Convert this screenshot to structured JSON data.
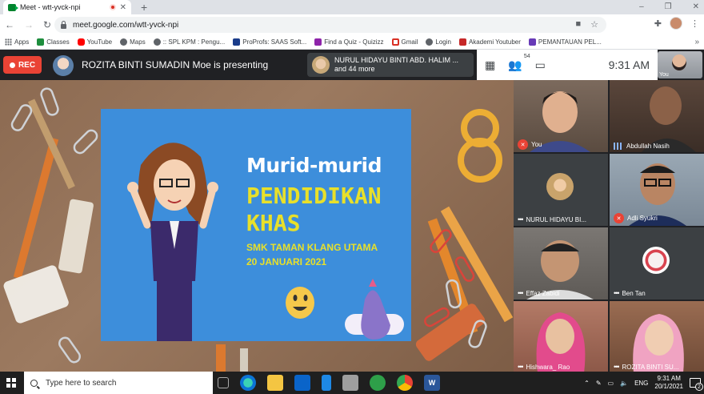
{
  "browser": {
    "tab_title": "Meet - wtt-yvck-npi",
    "tab_close": "✕",
    "new_tab": "+",
    "window_controls": [
      "–",
      "❐",
      "✕"
    ],
    "url": "meet.google.com/wtt-yvck-npi"
  },
  "bookmarks": [
    {
      "label": "Apps",
      "icon": "apps-grid-icon",
      "color": "#5f6368"
    },
    {
      "label": "Classes",
      "icon": "classroom-icon",
      "color": "#1e8e3e"
    },
    {
      "label": "YouTube",
      "icon": "youtube-icon",
      "color": "#ff0000"
    },
    {
      "label": "Maps",
      "icon": "globe-icon",
      "color": "#5f6368"
    },
    {
      "label": ":: SPL KPM : Pengu...",
      "icon": "globe-icon",
      "color": "#5f6368"
    },
    {
      "label": "ProProfs: SAAS Soft...",
      "icon": "proprofs-icon",
      "color": "#1a3c8a"
    },
    {
      "label": "Find a Quiz - Quizizz",
      "icon": "quizizz-icon",
      "color": "#8e24aa"
    },
    {
      "label": "Gmail",
      "icon": "gmail-icon",
      "color": "#d93025"
    },
    {
      "label": "Login",
      "icon": "globe-icon",
      "color": "#5f6368"
    },
    {
      "label": "Akademi Youtuber",
      "icon": "youtube-icon",
      "color": "#c62828"
    },
    {
      "label": "PEMANTAUAN PEL...",
      "icon": "forms-icon",
      "color": "#673ab7"
    }
  ],
  "bookmarks_more": "»",
  "meet": {
    "rec_label": "REC",
    "presenter_text": "ROZITA BINTI SUMADIN Moe is presenting",
    "participants_line1": "NURUL HIDAYU BINTI ABD. HALIM ...",
    "participants_line2": "and 44 more",
    "people_count": "54",
    "clock": "9:31 AM",
    "self_label": "You"
  },
  "slide": {
    "title": "Murid-murid",
    "subtitle1": "PENDIDIKAN",
    "subtitle2": "KHAS",
    "school": "SMK TAMAN KLANG UTAMA",
    "date": "20 JANUARI 2021"
  },
  "participants": [
    {
      "name": "You",
      "status": "muted",
      "bg": "#6d5c50"
    },
    {
      "name": "Abdullah Nasih",
      "status": "speaking",
      "bg": "#4a3a31"
    },
    {
      "name": "NURUL HIDAYU BI...",
      "status": "more",
      "bg": "#3c4043"
    },
    {
      "name": "Adli Syukri",
      "status": "muted",
      "bg": "#8a9aa8"
    },
    {
      "name": "Effaz Zabidi",
      "status": "more",
      "bg": "#6e6a66"
    },
    {
      "name": "Ben Tan",
      "status": "more",
      "bg": "#3c4043"
    },
    {
      "name": "Hishwara_ Rao",
      "status": "more",
      "bg": "#a36a5a"
    },
    {
      "name": "ROZITA BINTI SU...",
      "status": "more",
      "bg": "#8a6048"
    }
  ],
  "taskbar": {
    "search_placeholder": "Type here to search",
    "lang": "ENG",
    "time": "9:31 AM",
    "date": "20/1/2021",
    "notifications": "2"
  }
}
